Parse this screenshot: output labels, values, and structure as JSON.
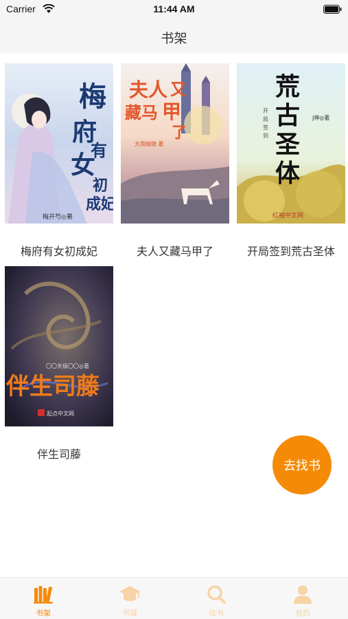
{
  "status_bar": {
    "carrier": "Carrier",
    "time": "11:44 AM"
  },
  "nav": {
    "title": "书架"
  },
  "books": [
    {
      "title": "梅府有女初成妃",
      "cover_text": "梅府有女初成妃",
      "cover_author": "梅开芍◎著"
    },
    {
      "title": "夫人又藏马甲了",
      "cover_text": "夫人又藏马甲了",
      "cover_author": "大雨暗隐 著"
    },
    {
      "title": "开局签到荒古圣体",
      "cover_text": "荒古圣体",
      "cover_sub": "开局签到",
      "cover_author": "J神◎著",
      "cover_publisher": "红袖中文网"
    },
    {
      "title": "伴生司藤",
      "cover_text": "伴生司藤",
      "cover_author": "〇〇天极〇〇◎著",
      "cover_publisher": "起点中文网"
    }
  ],
  "fab": {
    "label": "去找书"
  },
  "tabs": [
    {
      "label": "书架",
      "icon": "bookshelf-icon",
      "active": true
    },
    {
      "label": "书城",
      "icon": "graduation-cap-icon",
      "active": false
    },
    {
      "label": "找书",
      "icon": "search-icon",
      "active": false
    },
    {
      "label": "我的",
      "icon": "person-icon",
      "active": false
    }
  ],
  "colors": {
    "accent": "#f58a07",
    "tab_inactive": "#f8d3a6",
    "nav_bg": "#f5f5f5",
    "text": "#333333"
  }
}
